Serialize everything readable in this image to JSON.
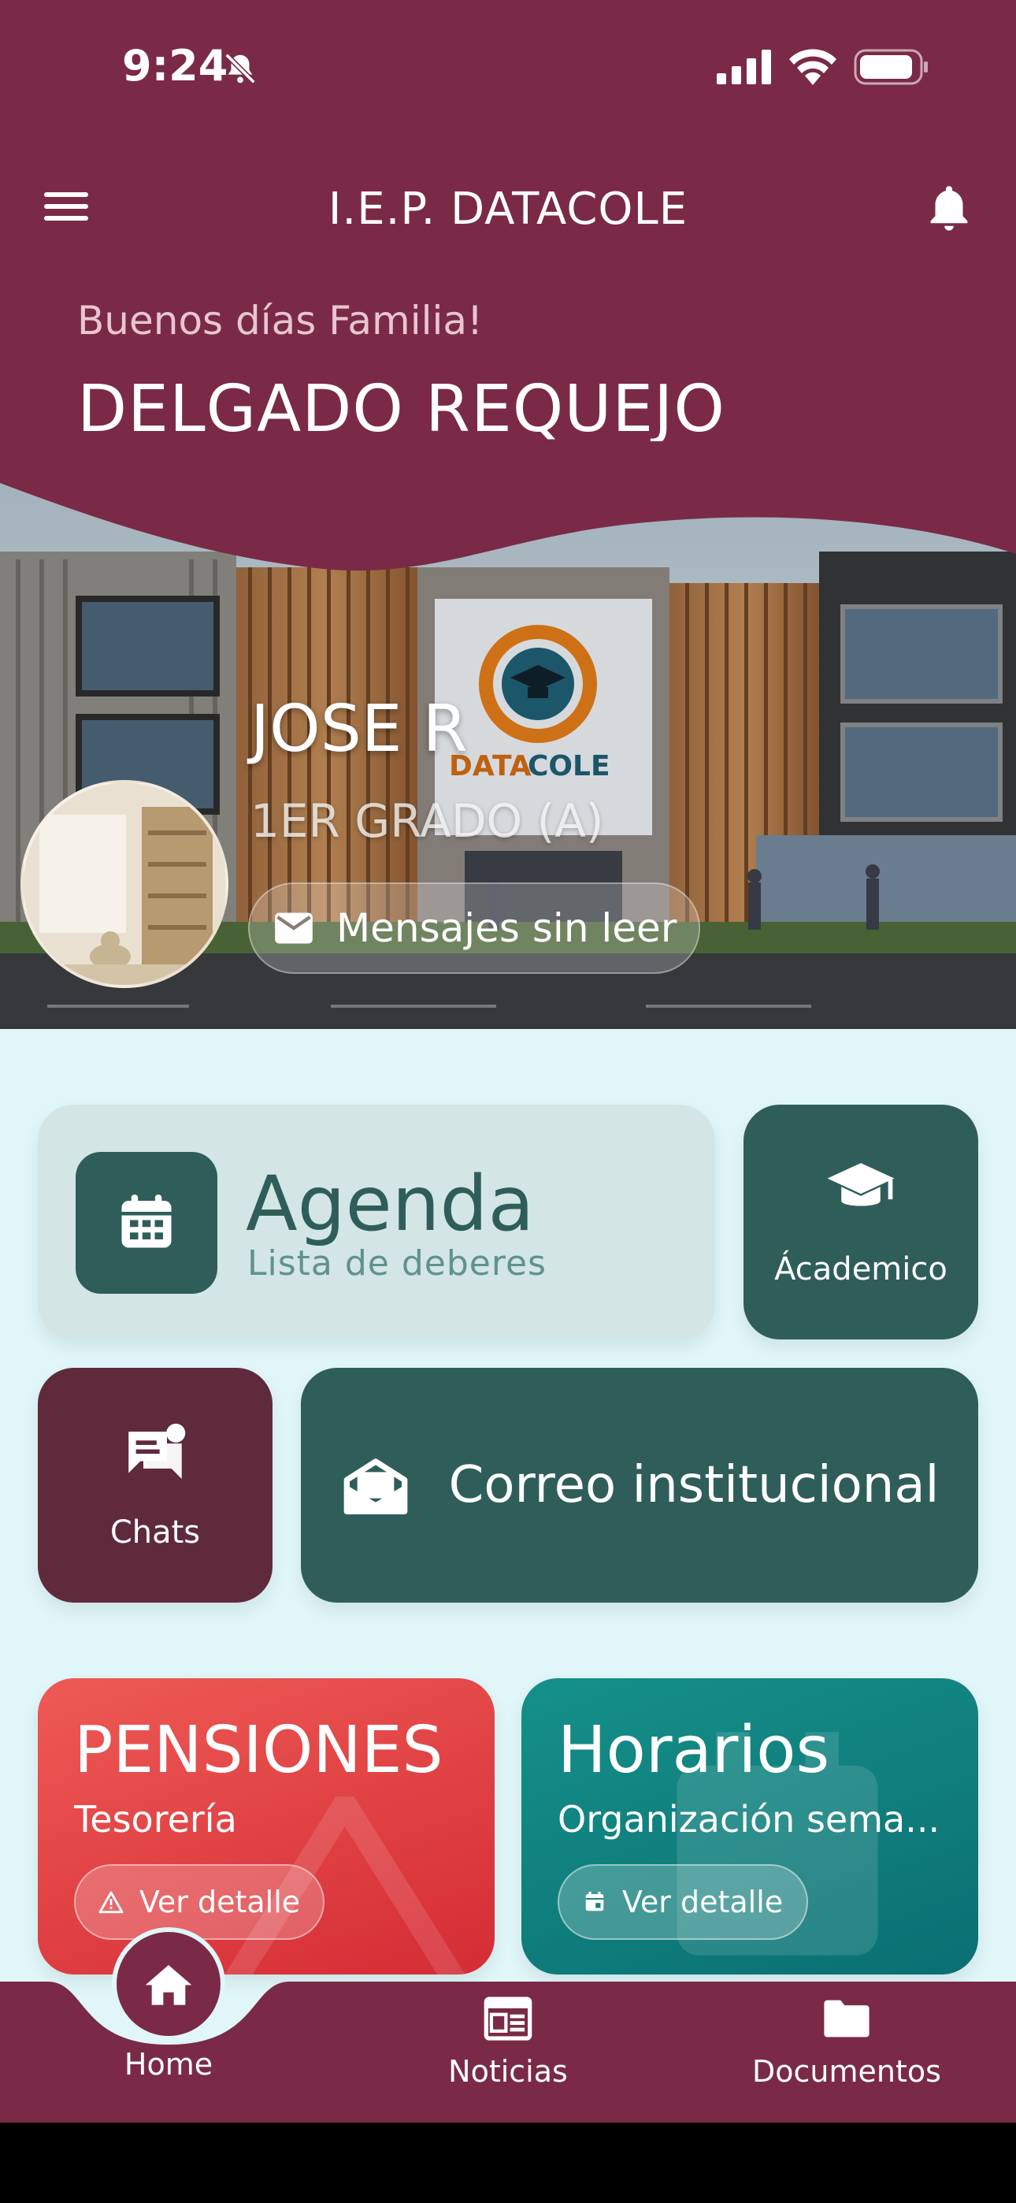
{
  "status_bar": {
    "time": "9:24"
  },
  "topbar": {
    "title": "I.E.P. DATACOLE"
  },
  "greeting": {
    "text": "Buenos días Familia!",
    "family": "DELGADO REQUEJO"
  },
  "student": {
    "name": "JOSE R",
    "grade": "1ER GRADO (A)",
    "unread_label": "Mensajes sin leer"
  },
  "banner": {
    "logo_text_1": "DATA",
    "logo_text_2": "COLE"
  },
  "cards": {
    "agenda": {
      "title": "Agenda",
      "subtitle": "Lista de deberes"
    },
    "academico": {
      "label": "Ácademico"
    },
    "chats": {
      "label": "Chats"
    },
    "correo": {
      "label": "Correo institucional"
    },
    "pensiones": {
      "title": "PENSIONES",
      "subtitle": "Tesorería",
      "button": "Ver detalle"
    },
    "horarios": {
      "title": "Horarios",
      "subtitle": "Organización sema...",
      "button": "Ver detalle"
    }
  },
  "bottom_nav": [
    {
      "label": "Home",
      "icon": "home-icon",
      "active": true
    },
    {
      "label": "Noticias",
      "icon": "newspaper-icon"
    },
    {
      "label": "Documentos",
      "icon": "folder-icon"
    }
  ],
  "colors": {
    "maroon": "#7a2a46",
    "teal": "#2f5e5a",
    "background": "#e0f6f8",
    "red": "#d42c35",
    "teal_bright": "#159089"
  }
}
